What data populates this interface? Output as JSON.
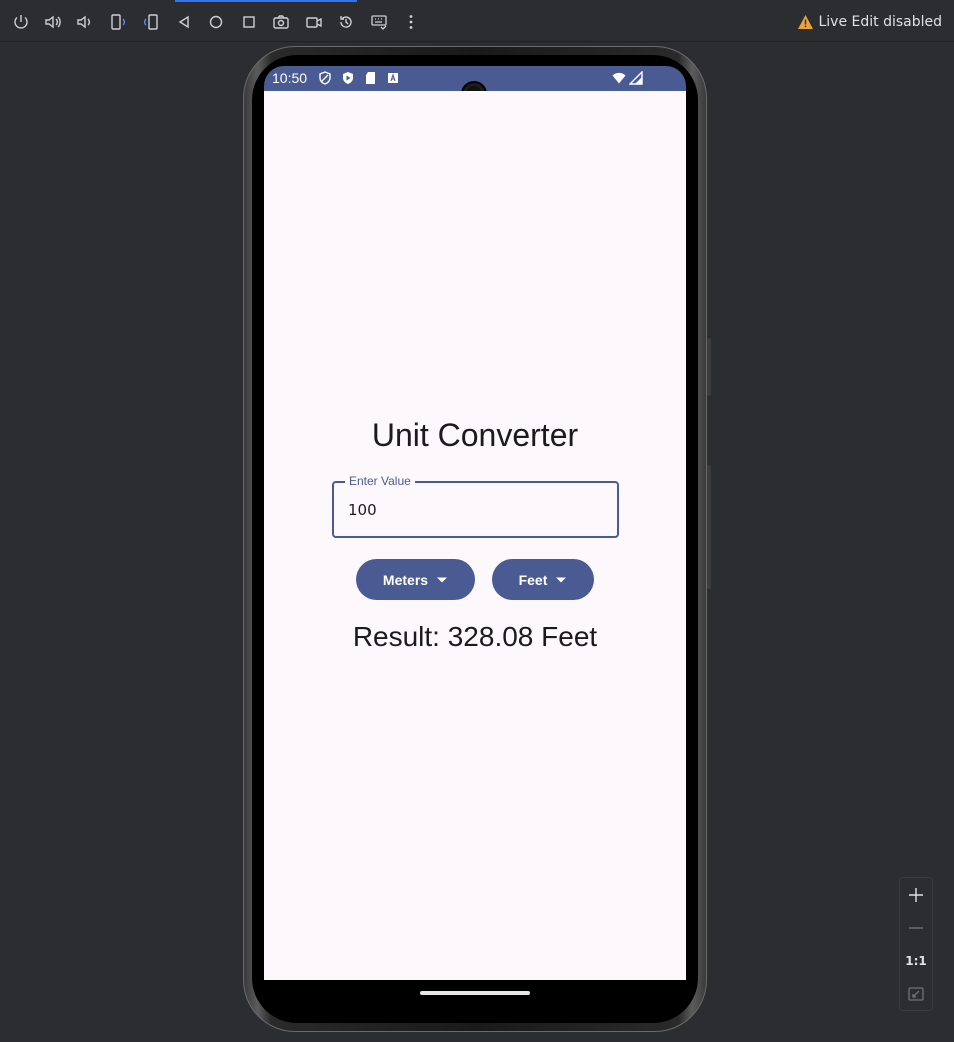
{
  "toolbar": {
    "live_edit_label": "Live Edit disabled",
    "warning_color": "#e9a33b",
    "icons": [
      "power-icon",
      "volume-up-icon",
      "volume-down-icon",
      "rotate-left-icon",
      "rotate-right-icon",
      "back-icon",
      "home-icon",
      "overview-icon",
      "screenshot-icon",
      "screen-record-icon",
      "reset-icon",
      "keyboard-icon",
      "more-icon"
    ]
  },
  "device": {
    "status_time": "10:50",
    "status_icons": [
      "shield-icon",
      "play-protect-icon",
      "sd-card-icon",
      "keyboard-a-icon",
      "wifi-icon",
      "signal-icon"
    ]
  },
  "app": {
    "title": "Unit Converter",
    "input_label": "Enter Value",
    "input_value": "100",
    "from_unit": "Meters",
    "to_unit": "Feet",
    "result": "Result: 328.08 Feet",
    "accent_color": "#4a5a92",
    "background_color": "#fcf8fc"
  },
  "zoom": {
    "actual_size_label": "1:1"
  }
}
